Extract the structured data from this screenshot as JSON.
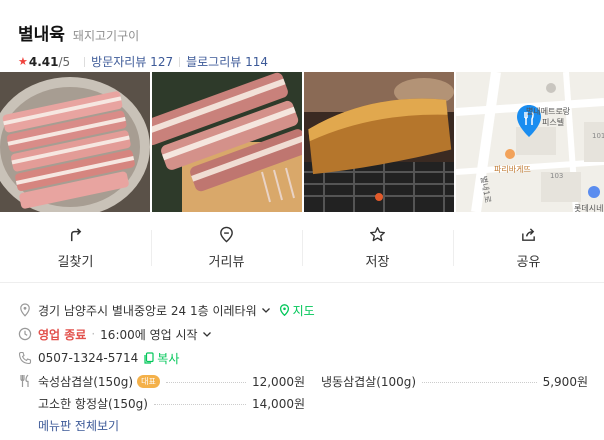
{
  "place": {
    "name": "별내육",
    "category": "돼지고기구이",
    "rating": "4.41",
    "rating_max": "/5",
    "visitor_reviews": "방문자리뷰 127",
    "blog_reviews": "블로그리뷰 114"
  },
  "map": {
    "label_mart": "별내메트로랑",
    "label_mart2": "피스텔",
    "label_bakery": "파리바게뜨",
    "label_road": "별내1로",
    "label_101": "101",
    "label_103": "103",
    "label_lotte": "롯데시네"
  },
  "actions": [
    {
      "label": "길찾기",
      "icon": "directions-icon"
    },
    {
      "label": "거리뷰",
      "icon": "street-view-icon"
    },
    {
      "label": "저장",
      "icon": "star-icon"
    },
    {
      "label": "공유",
      "icon": "share-icon"
    }
  ],
  "info": {
    "address": "경기 남양주시 별내중앙로 24 1층 이레타워",
    "map_link": "지도",
    "status": "영업 종료",
    "hours": "16:00에 영업 시작",
    "phone": "0507-1324-5714",
    "copy": "복사",
    "menu": [
      {
        "name": "숙성삼겹살(150g)",
        "tag": "대표",
        "price": "12,000원"
      },
      {
        "name": "냉동삼겹살(100g)",
        "tag": "",
        "price": "5,900원"
      },
      {
        "name": "고소한 항정살(150g)",
        "tag": "",
        "price": "14,000원"
      }
    ],
    "menu_more": "메뉴판 전체보기"
  },
  "colors": {
    "accent_blue": "#3d5a98",
    "green": "#03c75a",
    "red": "#e2514c",
    "map_pin": "#1a8df0"
  }
}
